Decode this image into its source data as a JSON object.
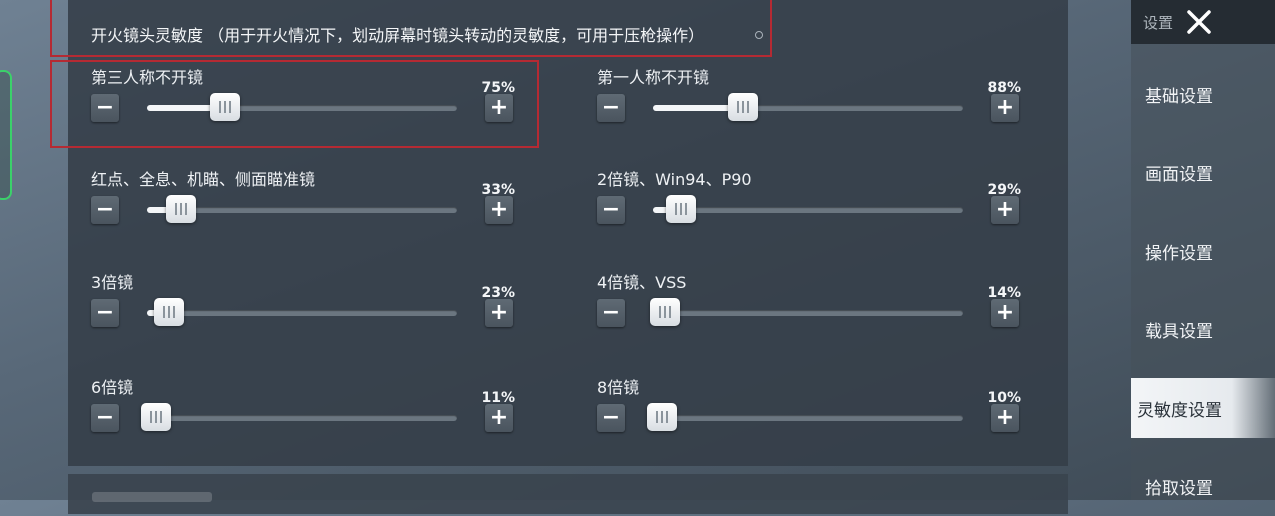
{
  "title": "开火镜头灵敏度 （用于开火情况下，划动屏幕时镜头转动的灵敏度，可用于压枪操作）",
  "sidebar": {
    "header": "设置",
    "items": [
      {
        "label": "基础设置",
        "active": false
      },
      {
        "label": "画面设置",
        "active": false
      },
      {
        "label": "操作设置",
        "active": false
      },
      {
        "label": "载具设置",
        "active": false
      },
      {
        "label": "灵敏度设置",
        "active": true
      },
      {
        "label": "拾取设置",
        "active": false
      }
    ]
  },
  "settings": [
    {
      "label": "第三人称不开镜",
      "value": "75%",
      "fraction": 0.25
    },
    {
      "label": "第一人称不开镜",
      "value": "88%",
      "fraction": 0.29
    },
    {
      "label": "红点、全息、机瞄、侧面瞄准镜",
      "value": "33%",
      "fraction": 0.11
    },
    {
      "label": "2倍镜、Win94、P90",
      "value": "29%",
      "fraction": 0.09
    },
    {
      "label": "3倍镜",
      "value": "23%",
      "fraction": 0.07
    },
    {
      "label": "4倍镜、VSS",
      "value": "14%",
      "fraction": 0.04
    },
    {
      "label": "6倍镜",
      "value": "11%",
      "fraction": 0.03
    },
    {
      "label": "8倍镜",
      "value": "10%",
      "fraction": 0.03
    }
  ],
  "icons": {
    "minus": "−",
    "plus": "+",
    "close": "close-icon"
  },
  "colors": {
    "highlight": "#b52a33",
    "active_tab": "#f3f5f7"
  }
}
